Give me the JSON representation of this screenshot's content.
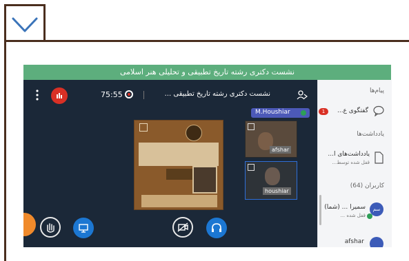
{
  "collapse": {
    "icon": "chevron-down-icon"
  },
  "banner": {
    "title": "نشست دکتری رشته تاریخ تطبیقی و تحلیلی هنر اسلامی"
  },
  "toolbar": {
    "menu_icon": "more-vertical-icon",
    "timer": "75:55",
    "meeting_title": "نشست دکتری رشته تاریخ تطبیقی ...",
    "users_icon": "users-icon"
  },
  "presenter": {
    "name": "M.Houshiar"
  },
  "participants": [
    {
      "name": "afshar"
    },
    {
      "name": "houshiar"
    }
  ],
  "sidebar": {
    "messages_heading": "پیام‌ها",
    "public_chat_label": "گفتگوی ع...",
    "public_chat_badge": "1",
    "notes_heading": "یادداشت‌ها",
    "shared_notes_label": "یادداشت‌های ا...",
    "shared_notes_sub": "قفل شده توسط...",
    "users_heading": "کاربران (64)",
    "user1_name": "سمیرا ... (شما)",
    "user1_sub": "قفل شده ...",
    "user1_avatar": "سم",
    "user2_name": "afshar"
  },
  "colors": {
    "banner": "#5dae7d",
    "main_bg": "#1b2838",
    "accent_blue": "#1c77d2",
    "recording_red": "#d93025",
    "frame_brown": "#4a2e1e"
  }
}
